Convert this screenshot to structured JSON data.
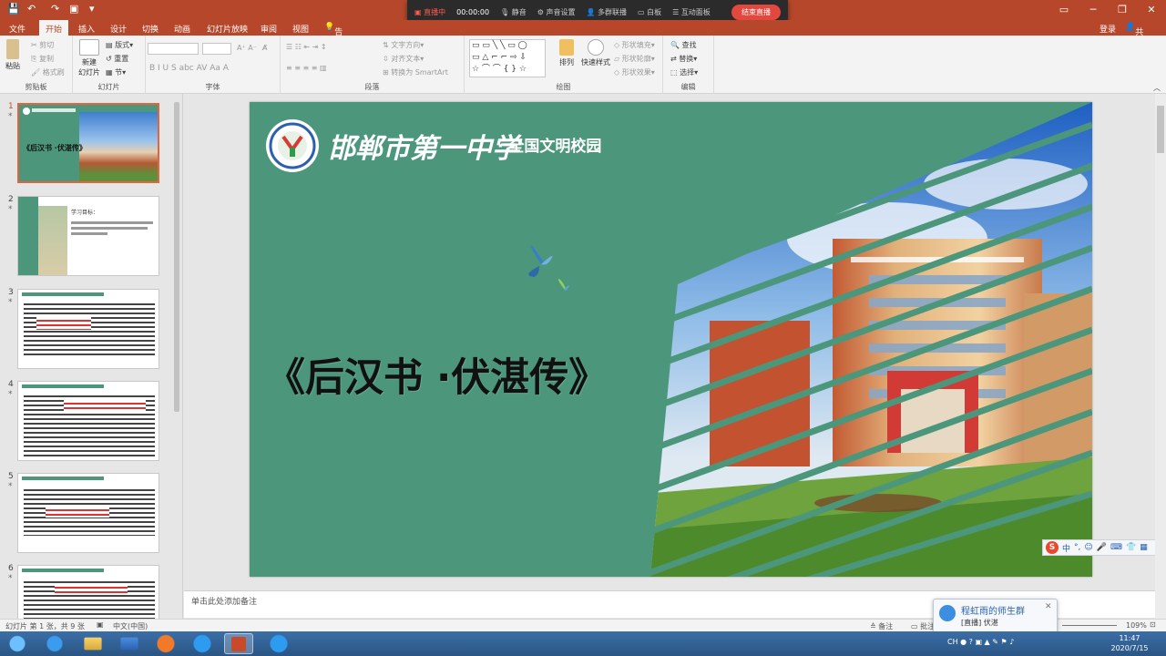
{
  "titlebar": {
    "signin": "登录",
    "share": "共享"
  },
  "live_toolbar": {
    "status": "直播中",
    "time": "00:00:00",
    "mute": "静音",
    "audio_settings": "声音设置",
    "multi_link": "多群联播",
    "whiteboard": "白板",
    "interact": "互动面板",
    "end_button": "结束直播"
  },
  "tabs": [
    "文件",
    "开始",
    "插入",
    "设计",
    "切换",
    "动画",
    "幻灯片放映",
    "审阅",
    "视图"
  ],
  "tell_me": "告诉我您想要做什么...",
  "ribbon": {
    "clipboard": {
      "label": "剪贴板",
      "paste": "粘贴",
      "cut": "剪切",
      "copy": "复制",
      "format_painter": "格式刷"
    },
    "slides": {
      "label": "幻灯片",
      "new_slide": "新建\n幻灯片",
      "layout": "版式",
      "reset": "重置",
      "section": "节"
    },
    "font": {
      "label": "字体"
    },
    "paragraph": {
      "label": "段落",
      "text_direction": "文字方向",
      "align_text": "对齐文本",
      "smartart": "转换为 SmartArt"
    },
    "drawing": {
      "label": "绘图",
      "arrange": "排列",
      "quick_styles": "快速样式",
      "shape_fill": "形状填充",
      "shape_outline": "形状轮廓",
      "shape_effects": "形状效果"
    },
    "editing": {
      "label": "编辑",
      "find": "查找",
      "replace": "替换",
      "select": "选择"
    }
  },
  "thumbnails": [
    {
      "num": "1",
      "caption": "《后汉书 ·伏湛传》"
    },
    {
      "num": "2",
      "caption": "学习目标："
    },
    {
      "num": "3",
      "caption": ""
    },
    {
      "num": "4",
      "caption": ""
    },
    {
      "num": "5",
      "caption": ""
    },
    {
      "num": "6",
      "caption": ""
    }
  ],
  "slide": {
    "school_name": "邯郸市第一中学",
    "school_suffix": "· 全国文明校园",
    "title": "《后汉书 ·伏湛传》"
  },
  "notes_placeholder": "单击此处添加备注",
  "status": {
    "slide_info": "幻灯片 第 1 张，共 9 张",
    "language": "中文(中国)",
    "notes": "备注",
    "comments": "批注",
    "zoom": "109%"
  },
  "popup": {
    "title": "程虹雨的师生群",
    "subtitle": "[直播] 伏湛"
  },
  "clock": {
    "time": "11:47",
    "date": "2020/7/15"
  },
  "colors": {
    "accent": "#b7472a",
    "slide_bg": "#4c977b"
  }
}
